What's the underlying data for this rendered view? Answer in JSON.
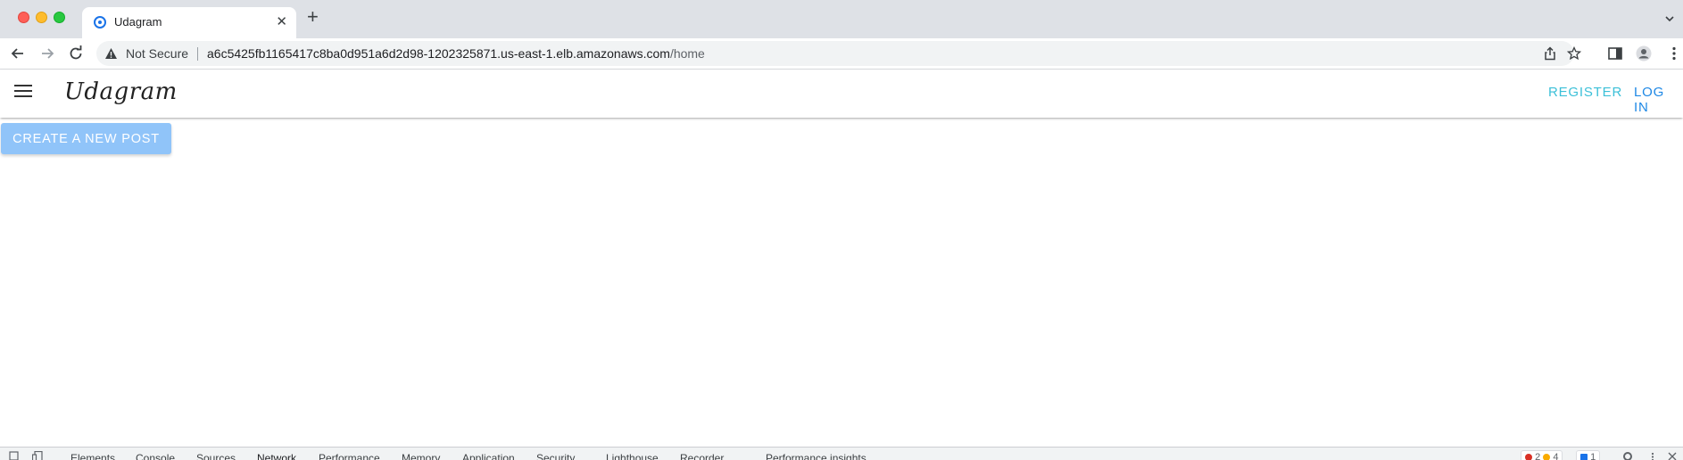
{
  "browser": {
    "tab": {
      "title": "Udagram",
      "close": "✕"
    },
    "new_tab": "+",
    "security_label": "Not Secure",
    "url_host": "a6c5425fb1165417c8ba0d951a6d2d98-1202325871.us-east-1.elb.amazonaws.com",
    "url_path": "/home"
  },
  "app": {
    "brand": "Udagram",
    "nav": {
      "register": "REGISTER",
      "login": "LOG IN"
    },
    "create_post_label": "CREATE A NEW POST"
  },
  "devtools": {
    "tabs": [
      "Elements",
      "Console",
      "Sources",
      "Network",
      "Performance",
      "Memory",
      "Application",
      "Security",
      "Lighthouse",
      "Recorder",
      "Performance insights"
    ],
    "active_tab": "Network",
    "errors": "2",
    "warnings": "4",
    "issues": "1"
  },
  "colors": {
    "register": "#3cc0d8",
    "login": "#1e88e5",
    "primary_button": "#90c4f9"
  }
}
